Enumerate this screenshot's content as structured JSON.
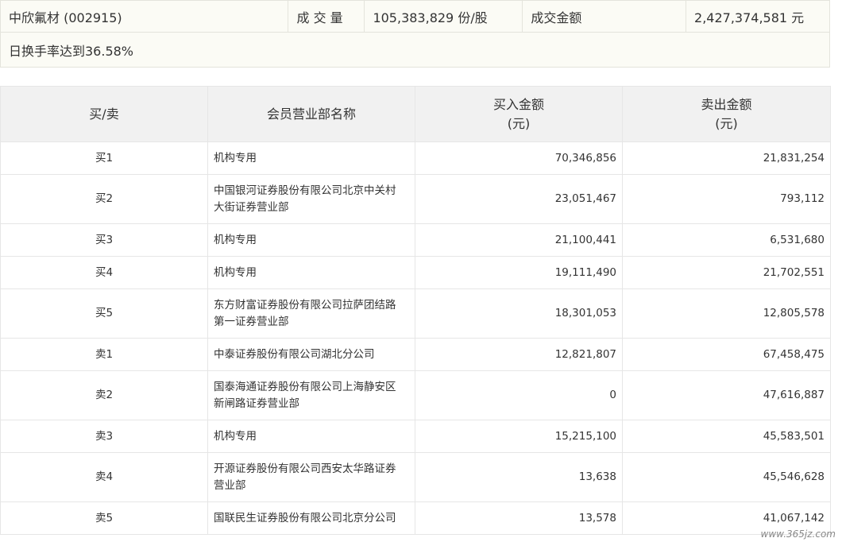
{
  "summary": {
    "stock": "中欣氟材 (002915)",
    "volume_label": "成 交 量",
    "volume_value": "105,383,829 份/股",
    "amount_label": "成交金额",
    "amount_value": "2,427,374,581 元",
    "note": "日换手率达到36.58%"
  },
  "table": {
    "headers": {
      "side": "买/卖",
      "name": "会员营业部名称",
      "buy_line1": "买入金额",
      "buy_line2": "(元)",
      "sell_line1": "卖出金额",
      "sell_line2": "(元)"
    },
    "rows": [
      {
        "side": "买1",
        "name_l1": "机构专用",
        "name_l2": "",
        "buy": "70,346,856",
        "sell": "21,831,254"
      },
      {
        "side": "买2",
        "name_l1": "中国银河证券股份有限公司北京中关村",
        "name_l2": "大街证券营业部",
        "buy": "23,051,467",
        "sell": "793,112"
      },
      {
        "side": "买3",
        "name_l1": "机构专用",
        "name_l2": "",
        "buy": "21,100,441",
        "sell": "6,531,680"
      },
      {
        "side": "买4",
        "name_l1": "机构专用",
        "name_l2": "",
        "buy": "19,111,490",
        "sell": "21,702,551"
      },
      {
        "side": "买5",
        "name_l1": "东方财富证券股份有限公司拉萨团结路",
        "name_l2": "第一证券营业部",
        "buy": "18,301,053",
        "sell": "12,805,578"
      },
      {
        "side": "卖1",
        "name_l1": "中泰证券股份有限公司湖北分公司",
        "name_l2": "",
        "buy": "12,821,807",
        "sell": "67,458,475"
      },
      {
        "side": "卖2",
        "name_l1": "国泰海通证券股份有限公司上海静安区",
        "name_l2": "新闸路证券营业部",
        "buy": "0",
        "sell": "47,616,887"
      },
      {
        "side": "卖3",
        "name_l1": "机构专用",
        "name_l2": "",
        "buy": "15,215,100",
        "sell": "45,583,501"
      },
      {
        "side": "卖4",
        "name_l1": "开源证券股份有限公司西安太华路证券",
        "name_l2": "营业部",
        "buy": "13,638",
        "sell": "45,546,628"
      },
      {
        "side": "卖5",
        "name_l1": "国联民生证券股份有限公司北京分公司",
        "name_l2": "",
        "buy": "13,578",
        "sell": "41,067,142"
      }
    ]
  },
  "watermark": "www.365jz.com"
}
